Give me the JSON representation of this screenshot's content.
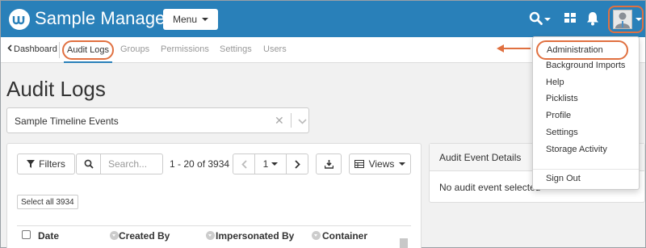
{
  "app": {
    "title": "Sample Manager",
    "menu_label": "Menu",
    "brand_color": "#2980b9",
    "highlight_color": "#e07040"
  },
  "header_icons": [
    "search-icon",
    "grid-icon",
    "bell-icon",
    "user-avatar"
  ],
  "subnav": {
    "back_label": "Dashboard",
    "active_label": "Audit Logs",
    "items": [
      "Groups",
      "Permissions",
      "Settings",
      "Users"
    ]
  },
  "page": {
    "title": "Audit Logs",
    "select_value": "Sample Timeline Events"
  },
  "grid": {
    "filters_label": "Filters",
    "search_placeholder": "Search...",
    "paging_text": "1 - 20 of 3934",
    "page_number": "1",
    "views_label": "Views",
    "select_all_label": "Select all 3934",
    "columns": [
      "Date",
      "Created By",
      "Impersonated By",
      "Container"
    ]
  },
  "details": {
    "title": "Audit Event Details",
    "empty_text": "No audit event selected"
  },
  "user_menu": {
    "items": [
      "Administration",
      "Background Imports",
      "Help",
      "Picklists",
      "Profile",
      "Settings",
      "Storage Activity"
    ],
    "sign_out_label": "Sign Out"
  }
}
